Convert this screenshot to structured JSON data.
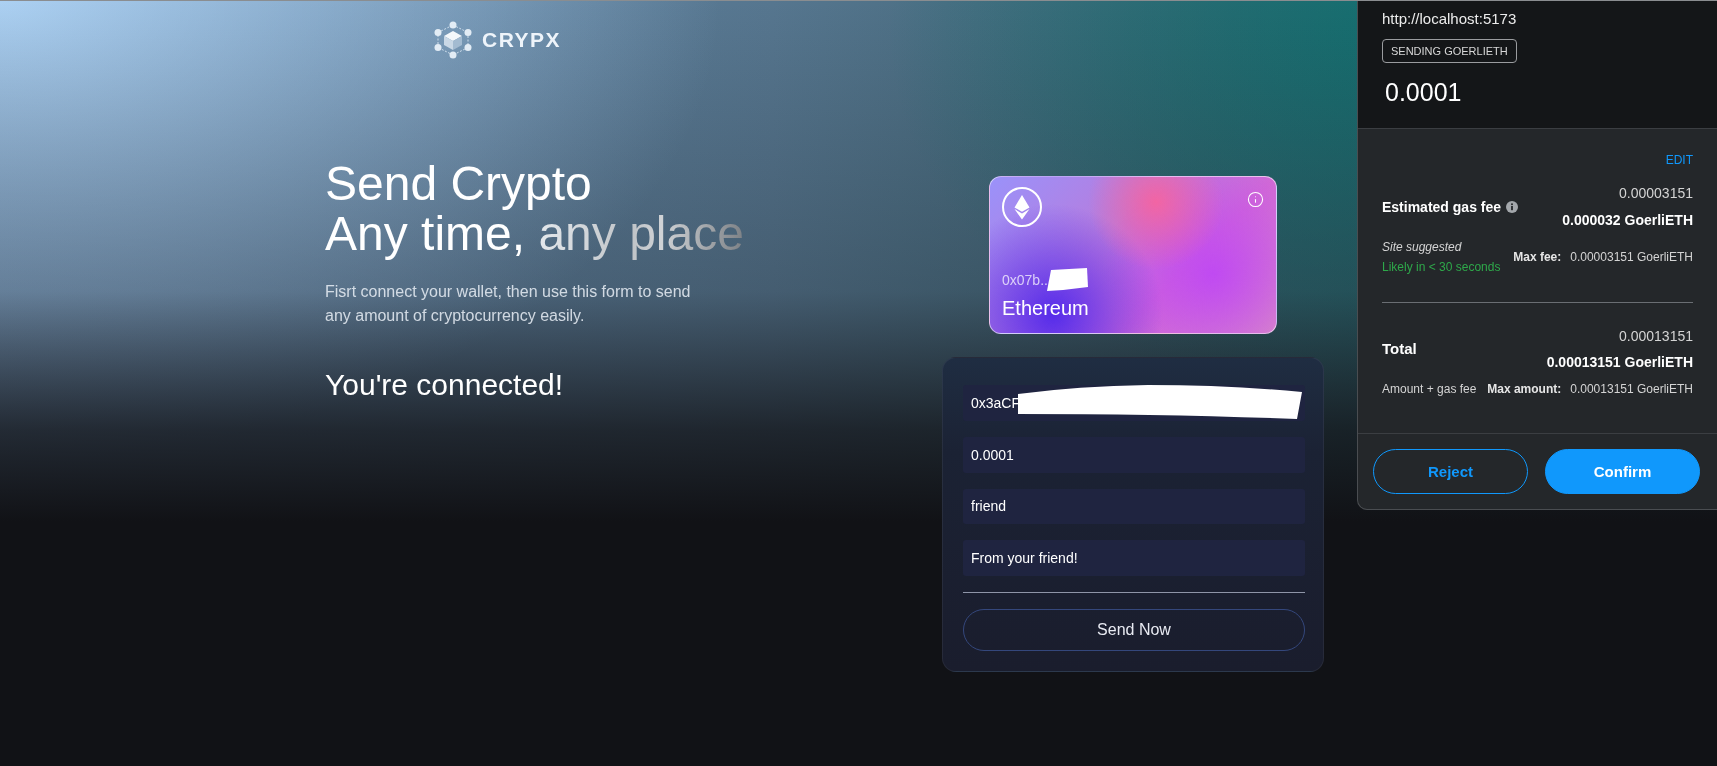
{
  "logo": {
    "name": "CRYPX"
  },
  "headline": {
    "line_1": "Send Crypto",
    "line_2": "Any time,",
    "highlight": "any place"
  },
  "description": [
    "Fisrt connect your wallet, then use this form to send",
    "any amount of cryptocurrency easily."
  ],
  "status": "You're connected!",
  "wallet_card": {
    "address": "0x07b..",
    "address_redacted": true,
    "network": "Ethereum"
  },
  "form": {
    "fields": [
      {
        "value": "0x3aCF",
        "redacted": true
      },
      {
        "value": "0.0001",
        "redacted": false
      },
      {
        "value": "friend",
        "redacted": false
      },
      {
        "value": "From your friend!",
        "redacted": false
      }
    ],
    "submit": "Send Now"
  },
  "wallet_popup": {
    "origin": "http://localhost:5173",
    "badge": "SENDING GOERLIETH",
    "amount": "0.0001",
    "edit_link": "EDIT",
    "gas_fee": {
      "label": "Estimated gas fee",
      "top_value": "0.00003151",
      "value": "0.000032 GoerliETH",
      "source": "Site suggested",
      "timing": "Likely in < 30 seconds",
      "max_label": "Max fee:",
      "max_value": "0.00003151 GoerliETH"
    },
    "total": {
      "label": "Total",
      "top_value": "0.00013151",
      "value": "0.00013151 GoerliETH",
      "note": "Amount + gas fee",
      "max_label": "Max amount:",
      "max_value": "0.00013151 GoerliETH"
    },
    "buttons": [
      {
        "label": "Reject",
        "kind": "secondary"
      },
      {
        "label": "Confirm",
        "kind": "primary"
      }
    ]
  }
}
